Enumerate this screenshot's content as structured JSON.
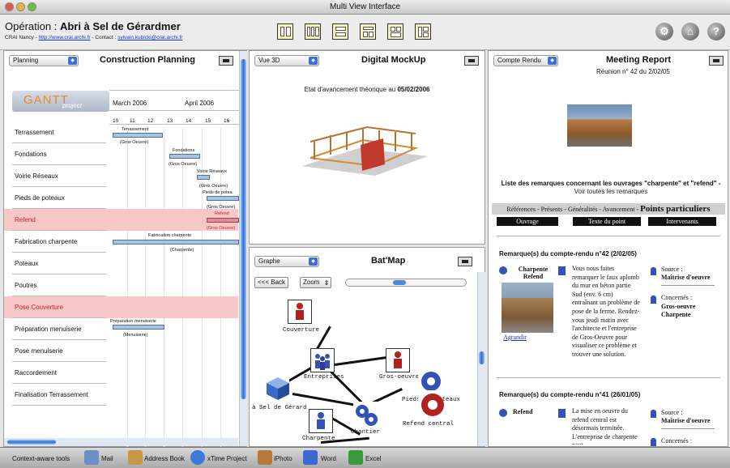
{
  "window": {
    "title": "Multi View Interface"
  },
  "header": {
    "op_label": "Opération : ",
    "op_name": "Abri à Sel de Gérardmer",
    "sub_prefix": "CRAI Nancy - ",
    "sub_link1": "http://www.crai.archi.fr",
    "sub_mid": " - Contact : ",
    "sub_link2": "sylvain.kubicki@crai.archi.fr"
  },
  "planning": {
    "select": "Planning",
    "title": "Construction Planning",
    "logo": "GANTT",
    "logo_sub": "project",
    "months": [
      "March 2006",
      "April 2006"
    ],
    "days": [
      "10",
      "11",
      "12",
      "13",
      "14",
      "15",
      "16"
    ],
    "tasks": [
      "Terrassement",
      "Fondations",
      "Voirie Réseaux",
      "Pieds de poteaux",
      "Refend",
      "Fabrication charpente",
      "Poteaux",
      "Poutres",
      "Pose Couverture",
      "Préparation menuiserie",
      "Pose menuiserie",
      "Raccordement",
      "Finalisation Terrassement"
    ],
    "bar_labels": {
      "t1": "Terrassement",
      "t1b": "(Gros Oeuvre)",
      "t2": "Fondations",
      "t2b": "(Gros Oeuvre)",
      "t3": "Voirie Réseaux",
      "t3b": "(Gros Oeuvre)",
      "t4": "Pieds de potea",
      "t4b": "(Gros Oeuvre)",
      "t5": "Refend",
      "t5b": "(Gros Oeuvre)",
      "t6": "Fabrication charpente",
      "t6b": "(Charpente)",
      "t7": "Préparation menuiserie",
      "t7b": "(Menuiserie)"
    }
  },
  "mockup": {
    "select": "Vue 3D",
    "title": "Digital MockUp",
    "state_prefix": "Etat d'avancement théorique au ",
    "state_date": "05/02/2006"
  },
  "batmap": {
    "select": "Graphe",
    "title": "Bat'Map",
    "back": "<<< Back",
    "zoom": "Zoom",
    "labels": {
      "couverture": "Couverture",
      "entreprises": "Entreprises",
      "gros": "Gros-oeuvre",
      "sel": "à Sel de Gérard",
      "pieds": "Pieds de poteaux",
      "chantier": "Chantier",
      "charpente": "Charpente",
      "refend": "Refend central"
    }
  },
  "report": {
    "select": "Compte Rendu",
    "title": "Meeting Report",
    "meeting": "Réunion n° 42 du 2/02/05",
    "list_title": "Liste des remarques concernant les ouvrages \"charpente\" et \"refend\" -",
    "list_link": "Voir toutes les remarques",
    "nav": "Références - Présents - Généralités - Avancement - ",
    "nav_big": "Points particuliers",
    "cols": [
      "Ouvrage",
      "Texte du point",
      "Intervenants"
    ],
    "sec1": "Remarque(s) du compte-rendu n°42 (2/02/05)",
    "r1_ouvrage": "Charpente Refend",
    "r1_text": "Vous nous faites remarquer le faux aplomb du mur en béton partie Sud (env. 6 cm) entraînant un problème de pose de la ferme. Rendez-vous jeudi matin avec l'architecte et l'entreprise de Gros-Oeuvre pour visualiser ce problème et trouver une solution.",
    "agrandir": "Agrandir",
    "source_label": "Source :",
    "source_val": "Maîtrise d'oeuvre",
    "conc_label": "Concernés :",
    "conc_val1": "Gros-oeuvre",
    "conc_val2": "Charpente",
    "sec2": "Remarque(s) du compte-rendu n°41 (26/01/05)",
    "r2_ouvrage": "Refend",
    "r2_text": "La mise en oeuvre du refend central est désormais terminée. L'entreprise de charpente peut",
    "source2_val": "Maîtrise d'oeuvre",
    "conc2_label": "Concernés :"
  },
  "dock": {
    "context": "Context-aware tools",
    "items": [
      "Mail",
      "Address Book",
      "xTime Project",
      "iPhoto",
      "Word",
      "Excel"
    ]
  }
}
